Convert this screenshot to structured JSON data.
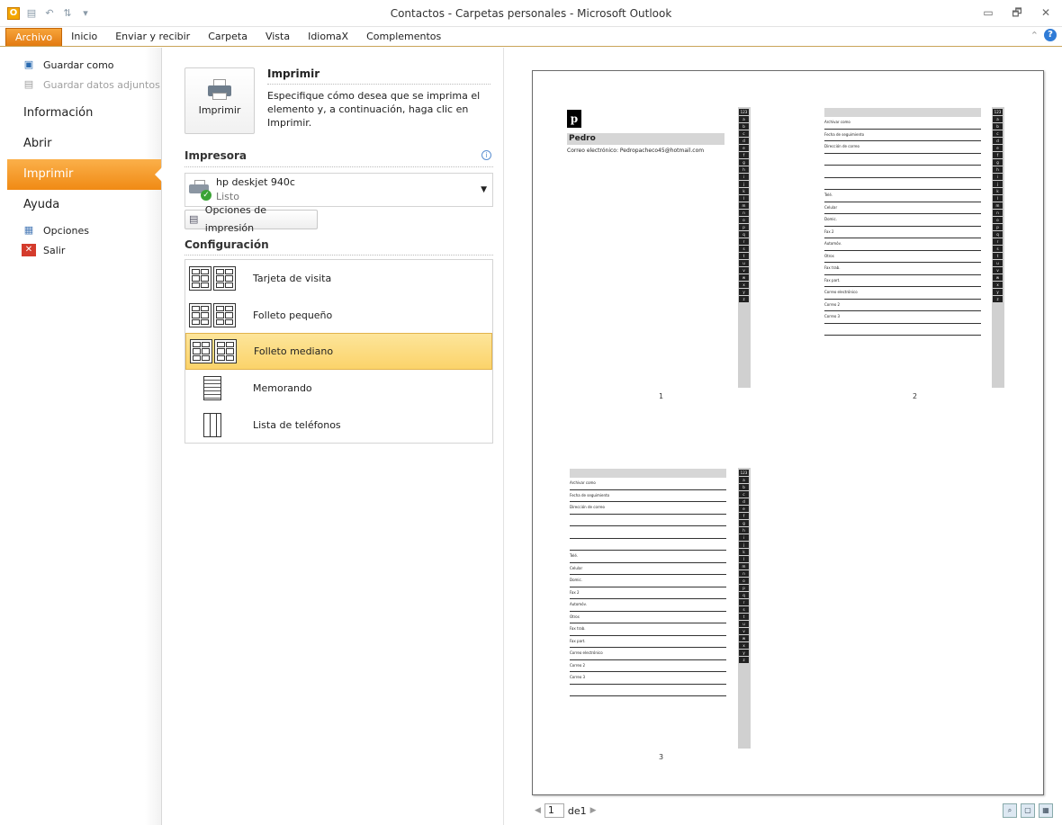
{
  "window": {
    "title": "Contactos - Carpetas personales - Microsoft Outlook",
    "app_icon": "O",
    "controls": [
      "▭",
      "🗗",
      "✕"
    ]
  },
  "ribbon": {
    "tabs": [
      "Archivo",
      "Inicio",
      "Enviar y recibir",
      "Carpeta",
      "Vista",
      "IdiomaX",
      "Complementos"
    ],
    "accent": "#e27a11"
  },
  "nav": {
    "small_top": [
      {
        "label": "Guardar como",
        "icon": "save-as-icon"
      },
      {
        "label": "Guardar datos adjuntos",
        "icon": "attachments-icon",
        "disabled": true
      }
    ],
    "big": [
      "Información",
      "Abrir",
      "Imprimir",
      "Ayuda"
    ],
    "active": "Imprimir",
    "small_bottom": [
      {
        "label": "Opciones",
        "icon": "options-icon"
      },
      {
        "label": "Salir",
        "icon": "exit-icon"
      }
    ]
  },
  "print": {
    "button_label": "Imprimir",
    "title": "Imprimir",
    "description": "Especifique cómo desea que se imprima el elemento y, a continuación, haga clic en Imprimir.",
    "printer_section": "Impresora",
    "printer_name": "hp deskjet 940c",
    "printer_status": "Listo",
    "options_button": "Opciones de impresión",
    "config_section": "Configuración",
    "styles": [
      {
        "label": "Tarjeta de visita",
        "icon": "business-card-icon"
      },
      {
        "label": "Folleto pequeño",
        "icon": "small-booklet-icon"
      },
      {
        "label": "Folleto mediano",
        "icon": "medium-booklet-icon"
      },
      {
        "label": "Memorando",
        "icon": "memo-icon"
      },
      {
        "label": "Lista de teléfonos",
        "icon": "phone-list-icon"
      }
    ],
    "selected_style": "Folleto mediano"
  },
  "preview": {
    "contact_initial": "p",
    "contact_name": "Pedro",
    "contact_email": "Correo electrónico:   Pedropacheco45@hotmail.com",
    "letters": [
      "123",
      "a",
      "b",
      "c",
      "d",
      "e",
      "f",
      "g",
      "h",
      "i",
      "j",
      "k",
      "l",
      "m",
      "n",
      "o",
      "p",
      "q",
      "r",
      "s",
      "t",
      "u",
      "v",
      "w",
      "x",
      "y",
      "z"
    ],
    "form_fields": [
      "Archivar como",
      "Fecha de seguimiento",
      "Dirección de correo",
      "",
      "",
      "",
      "Telé.",
      "Celular",
      "Domic.",
      "Fax 2",
      "Automóv.",
      "Otros",
      "Fax trab.",
      "Fax part.",
      "Correo electrónico",
      "Correo 2",
      "Correo 3",
      ""
    ],
    "page_numbers": [
      "1",
      "2",
      "3"
    ],
    "pager": {
      "current": "1",
      "of_label": "de1"
    }
  }
}
